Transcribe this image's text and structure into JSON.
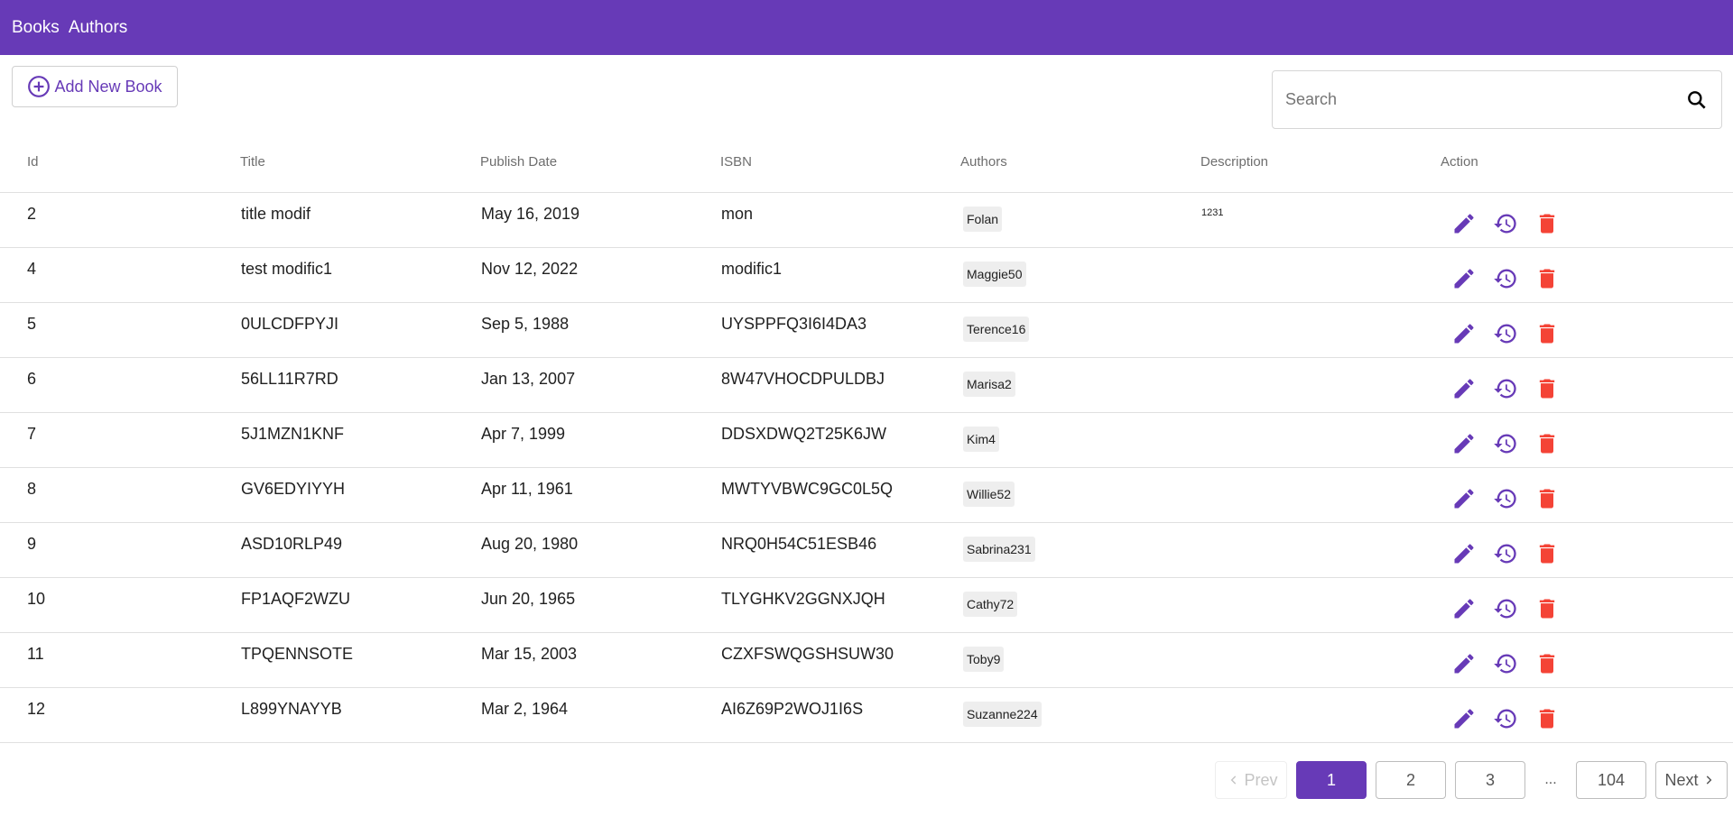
{
  "nav": {
    "books": "Books",
    "authors": "Authors"
  },
  "toolbar": {
    "add_label": "Add New Book",
    "search_placeholder": "Search",
    "search_value": ""
  },
  "table": {
    "headers": [
      "Id",
      "Title",
      "Publish Date",
      "ISBN",
      "Authors",
      "Description",
      "Action"
    ],
    "rows": [
      {
        "id": "2",
        "title": "title modif",
        "date": "May 16, 2019",
        "isbn": "mon",
        "author": "Folan",
        "desc": "1231"
      },
      {
        "id": "4",
        "title": "test modific1",
        "date": "Nov 12, 2022",
        "isbn": "modific1",
        "author": "Maggie50",
        "desc": ""
      },
      {
        "id": "5",
        "title": "0ULCDFPYJI",
        "date": "Sep 5, 1988",
        "isbn": "UYSPPFQ3I6I4DA3",
        "author": "Terence16",
        "desc": ""
      },
      {
        "id": "6",
        "title": "56LL11R7RD",
        "date": "Jan 13, 2007",
        "isbn": "8W47VHOCDPULDBJ",
        "author": "Marisa2",
        "desc": ""
      },
      {
        "id": "7",
        "title": "5J1MZN1KNF",
        "date": "Apr 7, 1999",
        "isbn": "DDSXDWQ2T25K6JW",
        "author": "Kim4",
        "desc": ""
      },
      {
        "id": "8",
        "title": "GV6EDYIYYH",
        "date": "Apr 11, 1961",
        "isbn": "MWTYVBWC9GC0L5Q",
        "author": "Willie52",
        "desc": ""
      },
      {
        "id": "9",
        "title": "ASD10RLP49",
        "date": "Aug 20, 1980",
        "isbn": "NRQ0H54C51ESB46",
        "author": "Sabrina231",
        "desc": ""
      },
      {
        "id": "10",
        "title": "FP1AQF2WZU",
        "date": "Jun 20, 1965",
        "isbn": "TLYGHKV2GGNXJQH",
        "author": "Cathy72",
        "desc": ""
      },
      {
        "id": "11",
        "title": "TPQENNSOTE",
        "date": "Mar 15, 2003",
        "isbn": "CZXFSWQGSHSUW30",
        "author": "Toby9",
        "desc": ""
      },
      {
        "id": "12",
        "title": "L899YNAYYB",
        "date": "Mar 2, 1964",
        "isbn": "AI6Z69P2WOJ1I6S",
        "author": "Suzanne224",
        "desc": ""
      }
    ]
  },
  "pagination": {
    "prev": "Prev",
    "next": "Next",
    "pages": [
      "1",
      "2",
      "3",
      "104"
    ],
    "ellipsis": "...",
    "current": "1"
  },
  "icons": {
    "edit": "edit-icon",
    "history": "history-icon",
    "delete": "delete-icon",
    "add": "add-circle-icon",
    "search": "search-icon"
  },
  "colors": {
    "primary": "#673ab7",
    "danger": "#f44336",
    "header_text": "#6e6e6e"
  }
}
